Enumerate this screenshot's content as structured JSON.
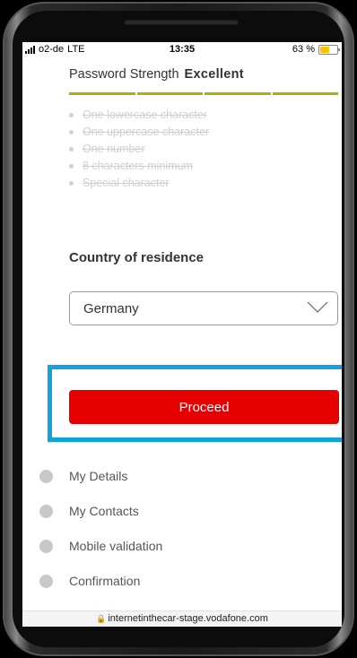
{
  "status_bar": {
    "carrier": "o2-de",
    "network": "LTE",
    "time": "13:35",
    "battery_text": "63 %",
    "battery_level": 0.63
  },
  "password": {
    "label": "Password Strength",
    "strength": "Excellent",
    "bar_color": "#a8b400",
    "requirements": [
      "One lowercase character",
      "One uppercase character",
      "One number",
      "8 characters minimum",
      "Special character"
    ]
  },
  "country": {
    "label": "Country of residence",
    "selected": "Germany"
  },
  "proceed_label": "Proceed",
  "colors": {
    "accent_red": "#e60000",
    "highlight_blue": "#12a2dd"
  },
  "steps": [
    "My Details",
    "My Contacts",
    "Mobile validation",
    "Confirmation"
  ],
  "url": "internetinthecar-stage.vodafone.com"
}
